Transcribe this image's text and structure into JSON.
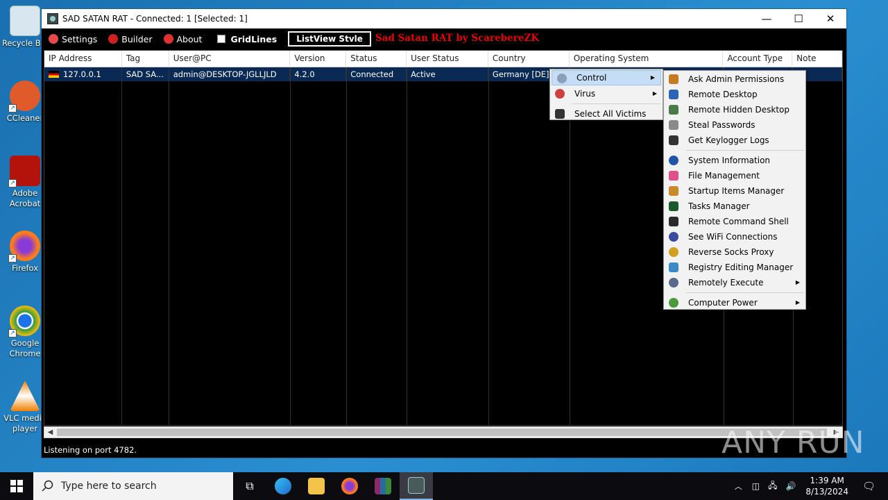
{
  "desktop": {
    "icons": [
      {
        "label": "Recycle Bin",
        "icon": "recycle-bin-icon",
        "color": "#d8e6f0"
      },
      {
        "label": "CCleaner",
        "icon": "ccleaner-icon",
        "color": "#e05a2a"
      },
      {
        "label": "Adobe Acrobat",
        "icon": "acrobat-icon",
        "color": "#b3130b"
      },
      {
        "label": "Firefox",
        "icon": "firefox-icon",
        "color": "#ff7b1a"
      },
      {
        "label": "Google Chrome",
        "icon": "chrome-icon",
        "color": "#2e9b45"
      },
      {
        "label": "VLC media player",
        "icon": "vlc-icon",
        "color": "#f08000"
      }
    ]
  },
  "window": {
    "title": "SAD SATAN RAT - Connected: 1 [Selected: 1]",
    "minimize": "—",
    "maximize": "☐",
    "close": "✕"
  },
  "menubar": {
    "settings": "Settings",
    "builder": "Builder",
    "about": "About",
    "gridlines": "GridLines",
    "listview_style": "ListView Stvle",
    "banner": "Sad Satan RAT by ScarebereZK"
  },
  "table": {
    "columns": [
      "IP Address",
      "Tag",
      "User@PC",
      "Version",
      "Status",
      "User Status",
      "Country",
      "Operating System",
      "Account Type",
      "Note"
    ],
    "rows": [
      {
        "ip": "127.0.0.1",
        "tag": "SAD SA...",
        "user": "admin@DESKTOP-JGLLJLD",
        "version": "4.2.0",
        "status": "Connected",
        "user_status": "Active",
        "country": "Germany [DE]",
        "os": "",
        "account": "",
        "note": ""
      }
    ]
  },
  "context_menu": {
    "items": [
      "Control",
      "Virus",
      "Select All Victims"
    ]
  },
  "control_submenu": {
    "items": [
      {
        "label": "Ask Admin Permissions",
        "icon": "shield-icon",
        "color": "#c87a1e"
      },
      {
        "label": "Remote Desktop",
        "icon": "monitor-icon",
        "color": "#2a63b8"
      },
      {
        "label": "Remote Hidden Desktop",
        "icon": "hidden-desktop-icon",
        "color": "#4a7a4a"
      },
      {
        "label": "Steal Passwords",
        "icon": "key-icon",
        "color": "#8a8a8a"
      },
      {
        "label": "Get Keylogger Logs",
        "icon": "keyboard-icon",
        "color": "#333333"
      },
      {
        "label": "System Information",
        "icon": "info-icon",
        "color": "#2255aa"
      },
      {
        "label": "File Management",
        "icon": "folder-icon",
        "color": "#e0508a"
      },
      {
        "label": "Startup Items Manager",
        "icon": "rocket-icon",
        "color": "#c88a2a"
      },
      {
        "label": "Tasks Manager",
        "icon": "tasks-icon",
        "color": "#1a5a2a"
      },
      {
        "label": "Remote Command Shell",
        "icon": "terminal-icon",
        "color": "#2a2a2a"
      },
      {
        "label": "See WiFi Connections",
        "icon": "wifi-icon",
        "color": "#3a4aa0"
      },
      {
        "label": "Reverse Socks Proxy",
        "icon": "proxy-icon",
        "color": "#d0a020"
      },
      {
        "label": "Registry Editing Manager",
        "icon": "registry-icon",
        "color": "#3a8ac8"
      },
      {
        "label": "Remotely Execute",
        "icon": "execute-icon",
        "color": "#5a6a8a"
      },
      {
        "label": "Computer Power",
        "icon": "power-icon",
        "color": "#4a9a3a"
      }
    ]
  },
  "status": "Listening on port 4782.",
  "watermark": "ANY RUN",
  "taskbar": {
    "search_placeholder": "Type here to search",
    "time": "1:39 AM",
    "date": "8/13/2024"
  }
}
